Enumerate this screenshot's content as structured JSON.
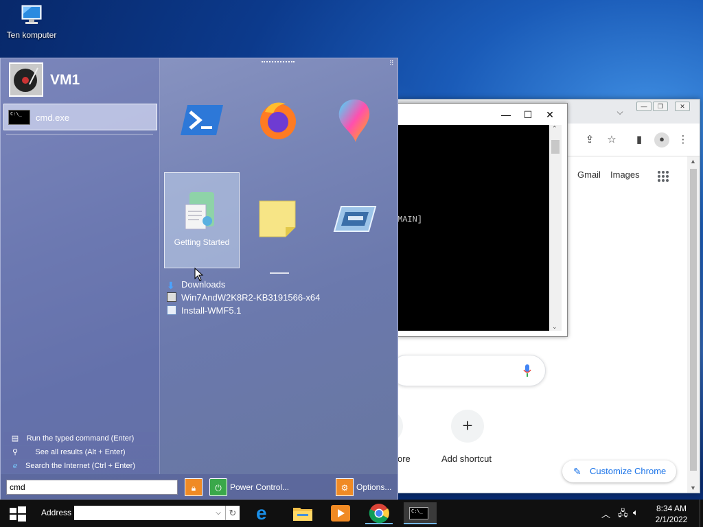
{
  "desktop": {
    "icons": [
      {
        "label": "Ten komputer",
        "icon": "computer-icon"
      }
    ]
  },
  "chrome": {
    "links": [
      "Gmail",
      "Images"
    ],
    "shortcut_partial_label": "ore",
    "add_shortcut_label": "Add shortcut",
    "customize_label": "Customize Chrome"
  },
  "cmd": {
    "text_fragment": "MAIN]"
  },
  "start_menu": {
    "user_name": "VM1",
    "recent_item": "cmd.exe",
    "tiles": [
      {
        "icon": "powershell-icon",
        "label": ""
      },
      {
        "icon": "firefox-icon",
        "label": ""
      },
      {
        "icon": "paint3d-icon",
        "label": ""
      },
      {
        "icon": "getting-started-icon",
        "label": "Getting Started"
      },
      {
        "icon": "sticky-notes-icon",
        "label": ""
      },
      {
        "icon": "remote-desktop-icon",
        "label": ""
      }
    ],
    "files": [
      {
        "label": "Downloads",
        "icon": "download-arrow-icon"
      },
      {
        "label": "Win7AndW2K8R2-KB3191566-x64",
        "icon": "msu-file-icon"
      },
      {
        "label": "Install-WMF5.1",
        "icon": "script-file-icon"
      }
    ],
    "actions": [
      {
        "label": "Run the typed command (Enter)",
        "icon": "run-icon"
      },
      {
        "label": "See all results (Alt + Enter)",
        "icon": "magnifier-icon"
      },
      {
        "label": "Search the Internet (Ctrl + Enter)",
        "icon": "ie-icon"
      }
    ],
    "search_value": "cmd",
    "power_label": "Power Control...",
    "options_label": "Options..."
  },
  "taskbar": {
    "address_label": "Address",
    "address_value": "",
    "time": "8:34 AM",
    "date": "2/1/2022"
  }
}
